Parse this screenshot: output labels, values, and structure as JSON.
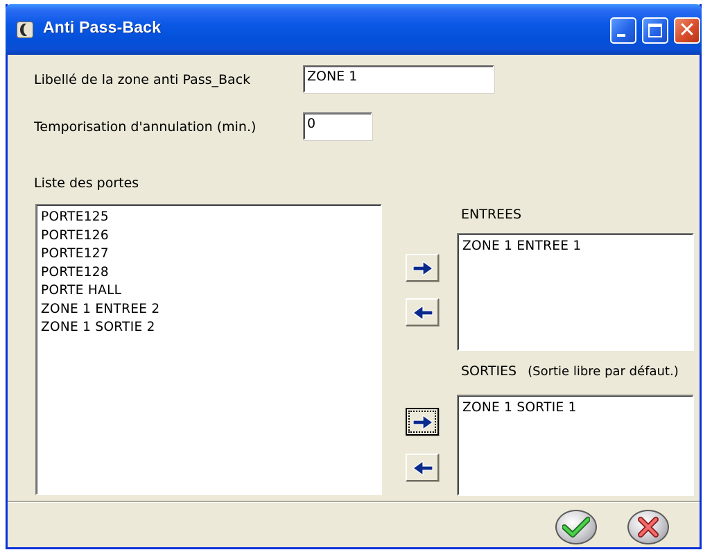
{
  "window": {
    "title": "Anti Pass-Back"
  },
  "form": {
    "zone_label_caption": "Libellé de la zone anti Pass_Back",
    "zone_label_value": "ZONE 1",
    "delay_caption": "Temporisation d'annulation (min.)",
    "delay_value": "0"
  },
  "doors": {
    "caption": "Liste des portes",
    "items": [
      "PORTE125",
      "PORTE126",
      "PORTE127",
      "PORTE128",
      "PORTE HALL",
      "ZONE 1 ENTREE 2",
      "ZONE 1 SORTIE 2"
    ]
  },
  "entrees": {
    "caption": "ENTREES",
    "items": [
      "ZONE 1 ENTREE 1"
    ]
  },
  "sorties": {
    "caption": "SORTIES",
    "note": "(Sortie libre par défaut.)",
    "items": [
      "ZONE 1 SORTIE 1"
    ]
  },
  "icons": {
    "app": "app-moon-icon",
    "move_right": "arrow-right-icon",
    "move_left": "arrow-left-icon",
    "ok": "check-icon",
    "cancel": "cancel-x-icon"
  },
  "colors": {
    "titlebar": "#0a58e6",
    "dialog_bg": "#ece9d8",
    "arrow": "#0a2a8c",
    "ok_check": "#2fb02f",
    "cancel_x": "#e03a3a"
  }
}
